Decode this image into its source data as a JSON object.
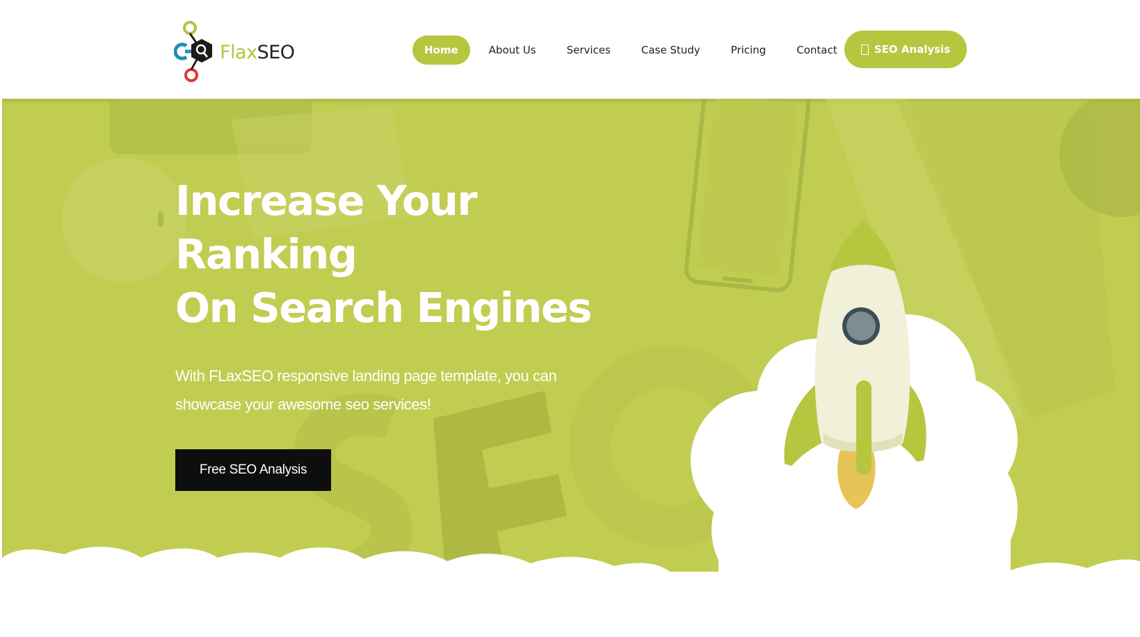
{
  "header": {
    "logo": {
      "part1": "Flax",
      "part2": "SEO"
    },
    "nav": [
      {
        "label": "Home",
        "active": true
      },
      {
        "label": "About Us",
        "active": false
      },
      {
        "label": "Services",
        "active": false
      },
      {
        "label": "Case Study",
        "active": false
      },
      {
        "label": "Pricing",
        "active": false
      },
      {
        "label": "Contact",
        "active": false
      }
    ],
    "cta": {
      "label": "SEO Analysis",
      "icon": "document-icon"
    }
  },
  "hero": {
    "title_lines": [
      "Increase Your",
      "Ranking",
      "On Search Engines"
    ],
    "subtitle": "With FLaxSEO responsive landing page template, you can showcase your awesome seo services!",
    "button_label": "Free SEO Analysis",
    "background_letters": "SEO"
  },
  "colors": {
    "accent": "#b7c63f",
    "hero_bg": "#c1cd51",
    "button_dark": "#0e0e0e",
    "rocket_body": "#f0f1d8",
    "rocket_window": "#7f8c90",
    "rocket_flame": "#e7c457"
  }
}
